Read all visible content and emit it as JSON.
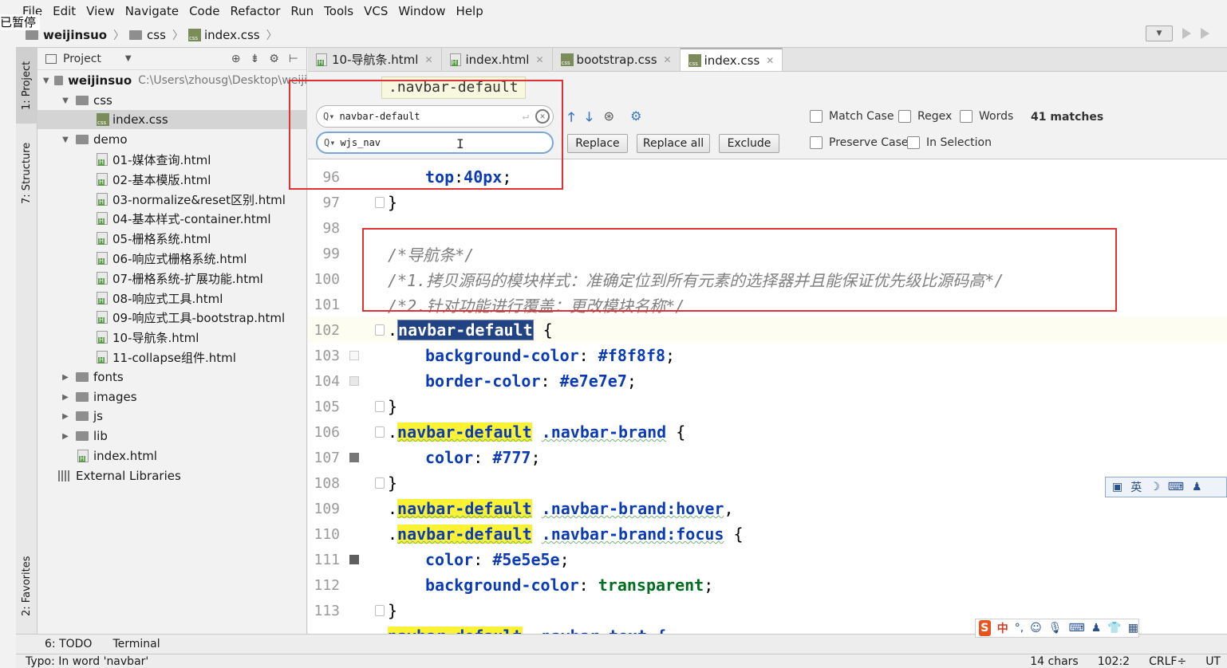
{
  "overlay_badge": "已暂停",
  "menu": [
    "File",
    "Edit",
    "View",
    "Navigate",
    "Code",
    "Refactor",
    "Run",
    "Tools",
    "VCS",
    "Window",
    "Help"
  ],
  "breadcrumb": {
    "project": "weijinsuo",
    "folder": "css",
    "file": "index.css"
  },
  "left_stripe": {
    "project_tab": "1: Project",
    "structure_tab": "7: Structure",
    "favorites_tab": "2: Favorites"
  },
  "project_panel": {
    "title": "Project",
    "root_name": "weijinsuo",
    "root_path": "C:\\Users\\zhousg\\Desktop\\weiji",
    "items": [
      {
        "label": "css"
      },
      {
        "label": "index.css"
      },
      {
        "label": "demo"
      },
      {
        "label": "01-媒体查询.html"
      },
      {
        "label": "02-基本模版.html"
      },
      {
        "label": "03-normalize&reset区别.html"
      },
      {
        "label": "04-基本样式-container.html"
      },
      {
        "label": "05-栅格系统.html"
      },
      {
        "label": "06-响应式栅格系统.html"
      },
      {
        "label": "07-栅格系统-扩展功能.html"
      },
      {
        "label": "08-响应式工具.html"
      },
      {
        "label": "09-响应式工具-bootstrap.html"
      },
      {
        "label": "10-导航条.html"
      },
      {
        "label": "11-collapse组件.html"
      },
      {
        "label": "fonts"
      },
      {
        "label": "images"
      },
      {
        "label": "js"
      },
      {
        "label": "lib"
      },
      {
        "label": "index.html"
      },
      {
        "label": "External Libraries"
      }
    ]
  },
  "editor_tabs": [
    "10-导航条.html",
    "index.html",
    "bootstrap.css",
    "index.css"
  ],
  "find": {
    "tooltip": ".navbar-default",
    "search_value": "navbar-default",
    "replace_value": "wjs_nav",
    "replace_label": "Replace",
    "replace_all_label": "Replace all",
    "exclude_label": "Exclude",
    "match_case": "Match Case",
    "regex": "Regex",
    "words": "Words",
    "preserve_case": "Preserve Case",
    "in_selection": "In Selection",
    "matches": "41 matches"
  },
  "code_lines": {
    "n96": "96",
    "n97": "97",
    "n98": "98",
    "n99": "99",
    "n100": "100",
    "n101": "101",
    "n102": "102",
    "n103": "103",
    "n104": "104",
    "n105": "105",
    "n106": "106",
    "n107": "107",
    "n108": "108",
    "n109": "109",
    "n110": "110",
    "n111": "111",
    "n112": "112",
    "n113": "113",
    "top_prop": "top",
    "top_val": "40px",
    "comment99": "/*导航条*/",
    "comment100": "/*1.拷贝源码的模块样式：准确定位到所有元素的选择器并且能保证优先级比源码高*/",
    "comment101": "/*2.针对功能进行覆盖：更改模块名称*/",
    "selector": "navbar-default",
    "bg_prop": "background-color",
    "bg_val": "#f8f8f8",
    "border_prop": "border-color",
    "border_val": "#e7e7e7",
    "brand": ".navbar-brand",
    "brand_hover": ".navbar-brand:hover",
    "brand_focus": ".navbar-brand:focus",
    "color_prop": "color",
    "color777": "#777",
    "color5e": "#5e5e5e",
    "transparent": "transparent",
    "partial114": ".navbar-text {"
  },
  "swatches": {
    "c103": "#f8f8f8",
    "c104": "#e7e7e7",
    "c107": "#777777",
    "c111": "#5e5e5e"
  },
  "bottom_tools": {
    "todo": "6: TODO",
    "terminal": "Terminal"
  },
  "status": {
    "message": "Typo: In word 'navbar'",
    "chars": "14 chars",
    "position": "102:2",
    "crlf": "CRLF÷",
    "enc": "UT"
  },
  "ime_bar": {
    "lang": "英",
    "brand": "S",
    "zh": "中"
  }
}
